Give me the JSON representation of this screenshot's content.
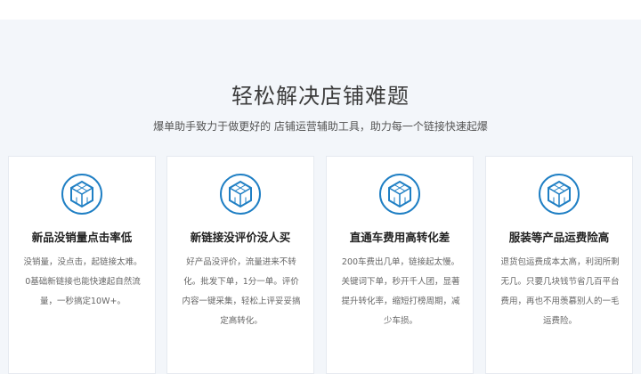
{
  "section": {
    "title": "轻松解决店铺难题",
    "subtitle": "爆单助手致力于做更好的 店铺运营辅助工具，助力每一个链接快速起爆"
  },
  "cards": [
    {
      "icon": "cube-icon",
      "title": "新品没销量点击率低",
      "description": "没销量，没点击，起链接太难。0基础新链接也能快速起自然流量，一秒搞定10W+。"
    },
    {
      "icon": "cube-icon",
      "title": "新链接没评价没人买",
      "description": "好产品没评价，流量进来不转化。批发下单，1分一单。评价内容一键采集，轻松上评妥妥搞定高转化。"
    },
    {
      "icon": "cube-icon",
      "title": "直通车费用高转化差",
      "description": "200车费出几单，链接起太慢。关键词下单，秒开千人团，显著提升转化率，缩短打榜周期，减少车损。"
    },
    {
      "icon": "cube-icon",
      "title": "服装等产品运费险高",
      "description": "退货包运费成本太高，利润所剩无几。只要几块钱节省几百平台费用，再也不用羡慕别人的一毛运费险。"
    }
  ],
  "colors": {
    "accent": "#1f7fc4",
    "background": "#f3f6fa",
    "card": "#ffffff"
  }
}
